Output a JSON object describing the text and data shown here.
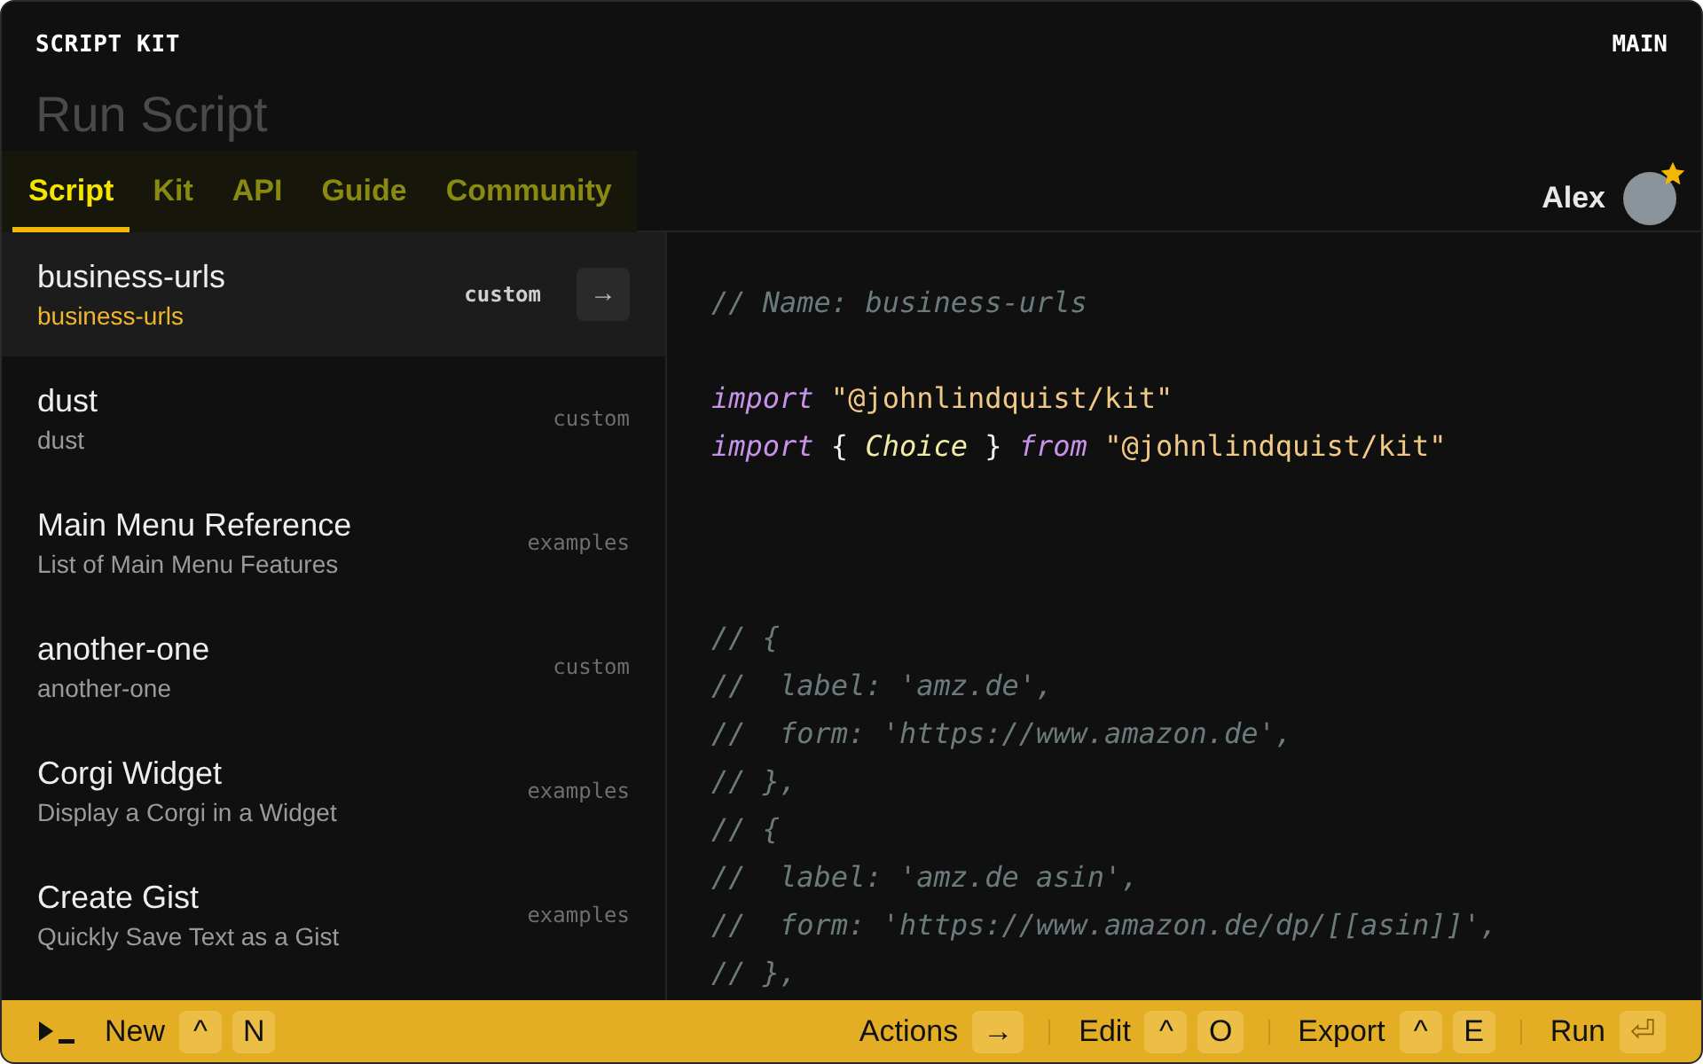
{
  "header": {
    "title": "SCRIPT KIT",
    "mode": "MAIN"
  },
  "input": {
    "placeholder": "Run Script"
  },
  "tabs": [
    {
      "label": "Script",
      "selected": true
    },
    {
      "label": "Kit",
      "selected": false
    },
    {
      "label": "API",
      "selected": false
    },
    {
      "label": "Guide",
      "selected": false
    },
    {
      "label": "Community",
      "selected": false
    }
  ],
  "user": {
    "name": "Alex"
  },
  "choices": [
    {
      "name": "business-urls",
      "description": "business-urls",
      "tag": "custom",
      "selected": true,
      "action": "→"
    },
    {
      "name": "dust",
      "description": "dust",
      "tag": "custom",
      "selected": false
    },
    {
      "name": "Main Menu Reference",
      "description": "List of Main Menu Features",
      "tag": "examples",
      "selected": false
    },
    {
      "name": "another-one",
      "description": "another-one",
      "tag": "custom",
      "selected": false
    },
    {
      "name": "Corgi Widget",
      "description": "Display a Corgi in a Widget",
      "tag": "examples",
      "selected": false
    },
    {
      "name": "Create Gist",
      "description": "Quickly Save Text as a Gist",
      "tag": "examples",
      "selected": false
    }
  ],
  "code": [
    {
      "kind": "line",
      "tokens": [
        {
          "kind": "comment",
          "text": "// Name: business-urls"
        }
      ]
    },
    {
      "kind": "blank"
    },
    {
      "kind": "line",
      "tokens": [
        {
          "kind": "keyword",
          "text": "import"
        },
        {
          "kind": "string",
          "text": "\"@johnlindquist/kit\""
        }
      ]
    },
    {
      "kind": "line",
      "tokens": [
        {
          "kind": "keyword",
          "text": "import"
        },
        {
          "kind": "punct",
          "text": "{"
        },
        {
          "kind": "type",
          "text": "Choice"
        },
        {
          "kind": "punct",
          "text": "}"
        },
        {
          "kind": "keyword",
          "text": "from"
        },
        {
          "kind": "string",
          "text": "\"@johnlindquist/kit\""
        }
      ]
    },
    {
      "kind": "blank"
    },
    {
      "kind": "blank"
    },
    {
      "kind": "blank"
    },
    {
      "kind": "line",
      "tokens": [
        {
          "kind": "comment",
          "text": "// {"
        }
      ]
    },
    {
      "kind": "line",
      "tokens": [
        {
          "kind": "comment",
          "text": "//  label: 'amz.de',"
        }
      ]
    },
    {
      "kind": "line",
      "tokens": [
        {
          "kind": "comment",
          "text": "//  form: 'https://www.amazon.de',"
        }
      ]
    },
    {
      "kind": "line",
      "tokens": [
        {
          "kind": "comment",
          "text": "// },"
        }
      ]
    },
    {
      "kind": "line",
      "tokens": [
        {
          "kind": "comment",
          "text": "// {"
        }
      ]
    },
    {
      "kind": "line",
      "tokens": [
        {
          "kind": "comment",
          "text": "//  label: 'amz.de asin',"
        }
      ]
    },
    {
      "kind": "line",
      "tokens": [
        {
          "kind": "comment",
          "text": "//  form: 'https://www.amazon.de/dp/[[asin]]',"
        }
      ]
    },
    {
      "kind": "line",
      "tokens": [
        {
          "kind": "comment",
          "text": "// },"
        }
      ]
    }
  ],
  "footer": {
    "left": [
      {
        "label": "New",
        "keys": [
          {
            "text": "^",
            "disabled": false
          },
          {
            "text": "N",
            "disabled": false
          }
        ]
      }
    ],
    "right": [
      {
        "label": "Actions",
        "keys": [
          {
            "text": "→",
            "disabled": false
          }
        ]
      },
      {
        "label": "Edit",
        "keys": [
          {
            "text": "^",
            "disabled": false
          },
          {
            "text": "O",
            "disabled": false
          }
        ]
      },
      {
        "label": "Export",
        "keys": [
          {
            "text": "^",
            "disabled": false
          },
          {
            "text": "E",
            "disabled": false
          }
        ]
      },
      {
        "label": "Run",
        "keys": [
          {
            "text": "⏎",
            "disabled": true
          }
        ]
      }
    ]
  }
}
